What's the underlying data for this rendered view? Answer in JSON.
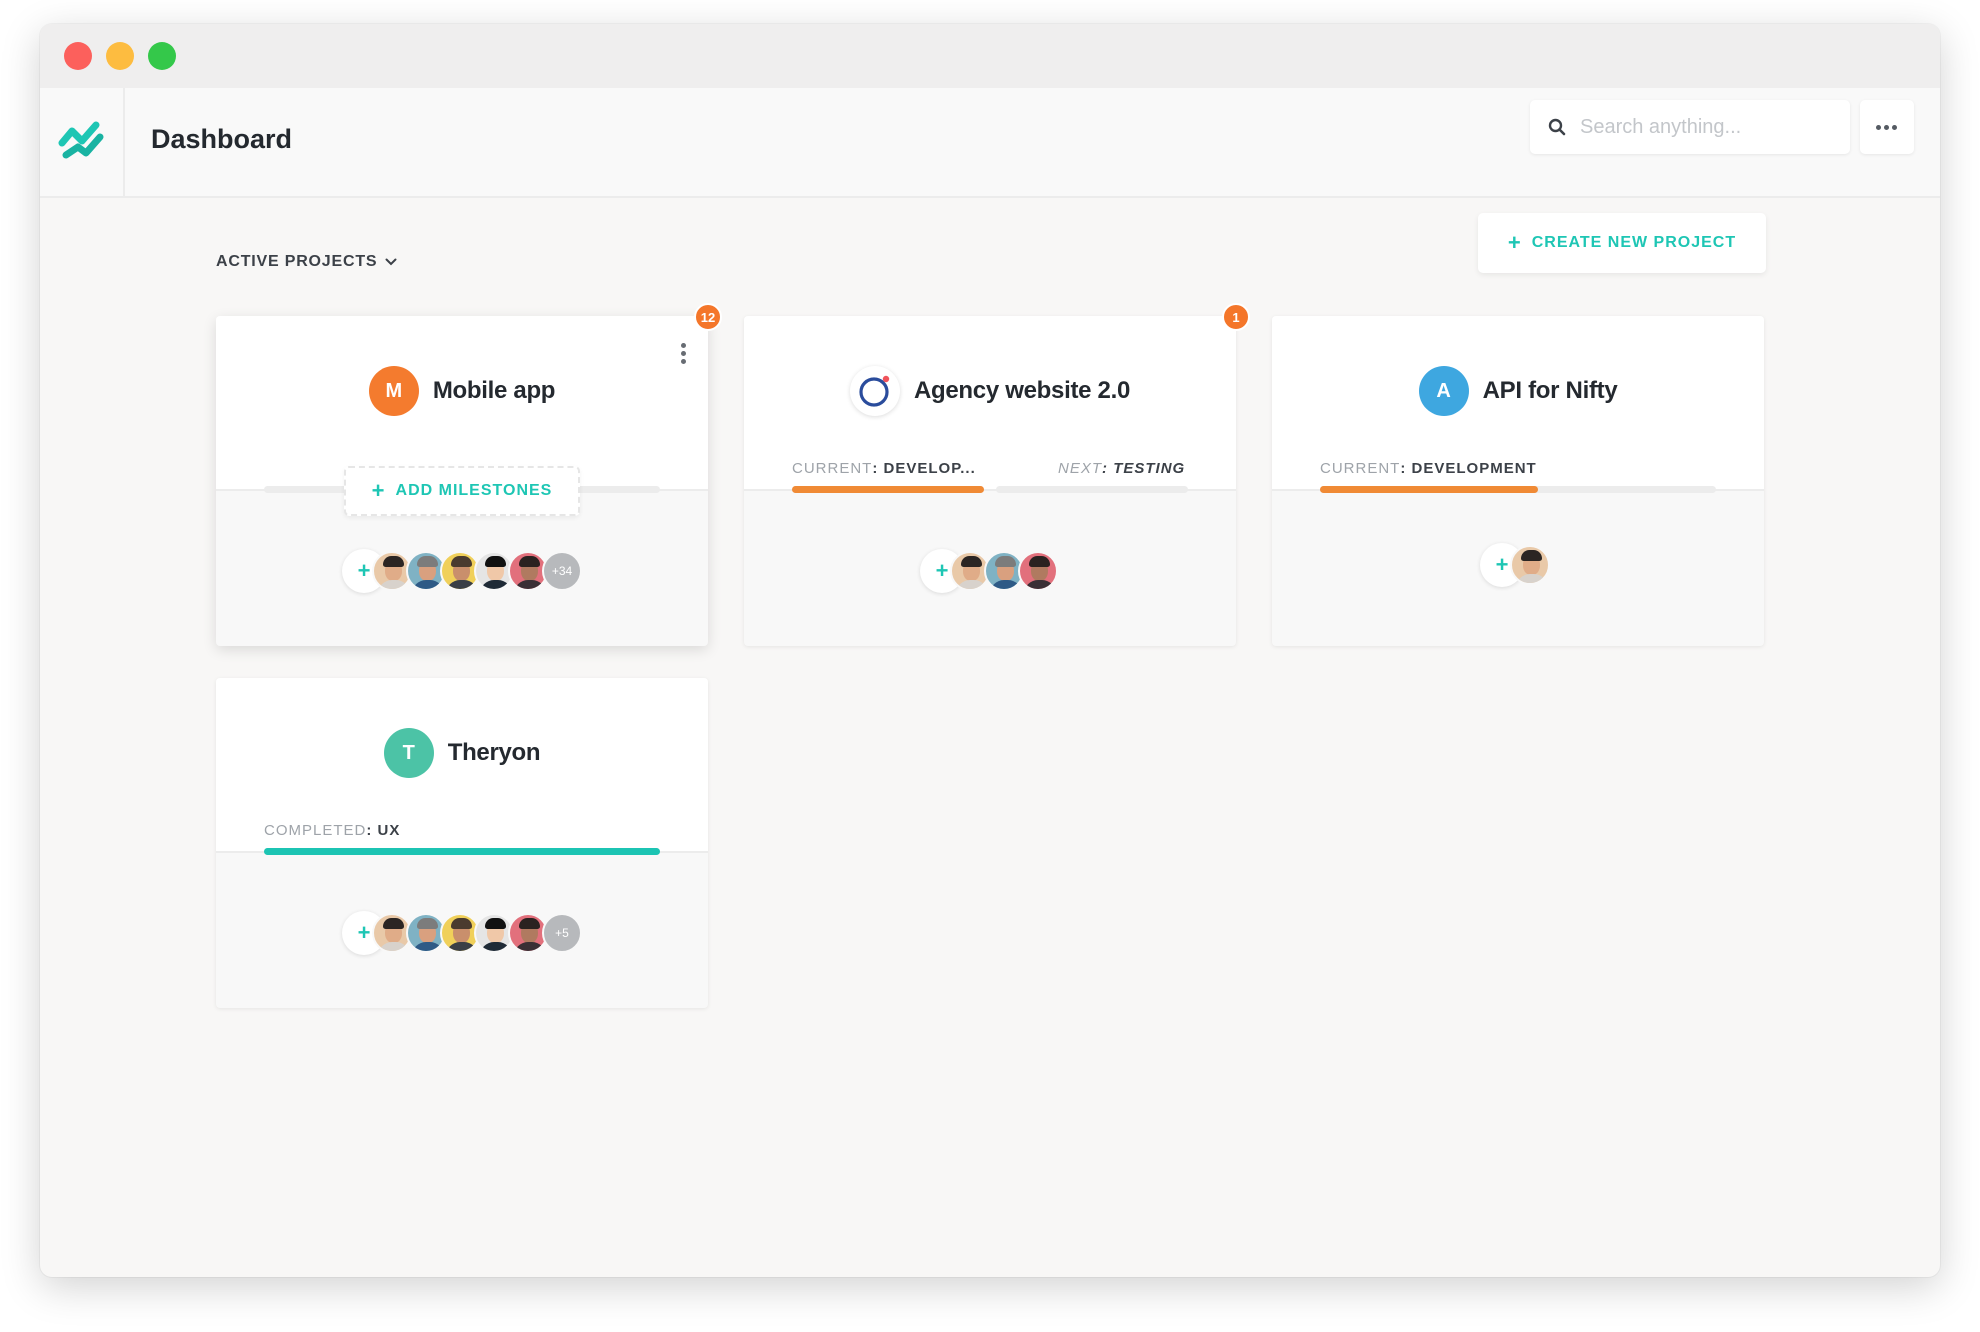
{
  "app": {
    "title": "Dashboard",
    "logo_icon": "nifty-logo-icon",
    "search_placeholder": "Search anything...",
    "more_icon": "more-horizontal-icon"
  },
  "toolbar": {
    "filter_label": "ACTIVE PROJECTS",
    "filter_icon": "chevron-down-icon",
    "create_label": "CREATE NEW PROJECT"
  },
  "colors": {
    "accent": "#1ec6b4",
    "badge": "#f4762a",
    "progress_orange": "#f08a35",
    "progress_teal": "#1cc4b3"
  },
  "projects": [
    {
      "name": "Mobile app",
      "initial": "M",
      "avatar_color": "#f47b2e",
      "badge": "12",
      "milestone_action": "ADD MILESTONES",
      "extra_members": "+34"
    },
    {
      "name": "Agency website 2.0",
      "avatar_icon": "ring-logo-icon",
      "badge": "1",
      "current_label": "CURRENT",
      "current_value": "DEVELOP...",
      "current_progress": 1.0,
      "next_label": "NEXT",
      "next_value": "TESTING",
      "next_progress": 0.0
    },
    {
      "name": "API for Nifty",
      "initial": "A",
      "avatar_color": "#3ea7e0",
      "current_label": "CURRENT",
      "current_value": "DEVELOPMENT",
      "current_progress": 0.55
    },
    {
      "name": "Theryon",
      "initial": "T",
      "avatar_color": "#4cc3a6",
      "completed_label": "COMPLETED",
      "completed_value": "UX",
      "completed_progress": 1.0,
      "extra_members": "+5"
    }
  ]
}
